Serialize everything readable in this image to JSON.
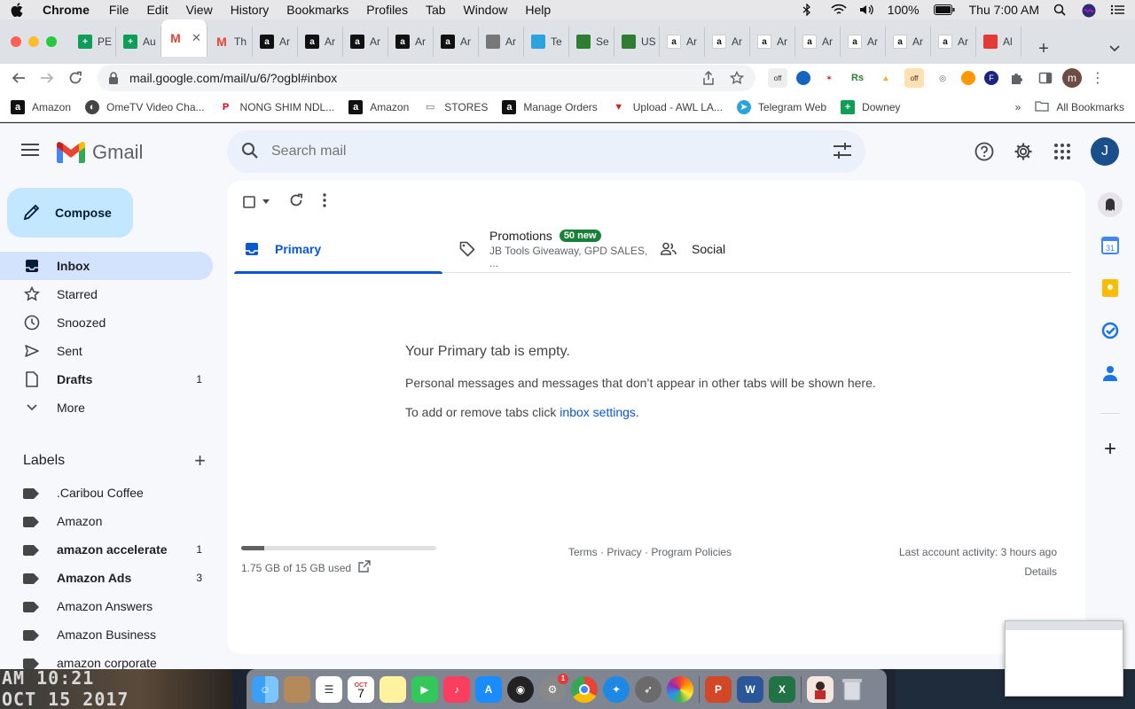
{
  "menubar": {
    "app": "Chrome",
    "items": [
      "File",
      "Edit",
      "View",
      "History",
      "Bookmarks",
      "Profiles",
      "Tab",
      "Window",
      "Help"
    ],
    "battery": "100%",
    "clock": "Thu 7:00 AM"
  },
  "tabs": [
    {
      "label": "PE",
      "icon": "sheets-icon",
      "color": "#0f9d58"
    },
    {
      "label": "Au",
      "icon": "sheets-icon",
      "color": "#0f9d58"
    },
    {
      "label": "",
      "icon": "gmail-icon",
      "color": "#ea4335",
      "active": true
    },
    {
      "label": "Th",
      "icon": "gmail-icon",
      "color": "#ea4335"
    },
    {
      "label": "Ar",
      "icon": "amazon-icon",
      "color": "#111111"
    },
    {
      "label": "Ar",
      "icon": "amazon-icon",
      "color": "#111111"
    },
    {
      "label": "Ar",
      "icon": "amazon-icon",
      "color": "#111111"
    },
    {
      "label": "Ar",
      "icon": "amazon-icon",
      "color": "#111111"
    },
    {
      "label": "Ar",
      "icon": "amazon-icon",
      "color": "#111111"
    },
    {
      "label": "Ar",
      "icon": "generic-icon",
      "color": "#777777"
    },
    {
      "label": "Te",
      "icon": "telegram-icon",
      "color": "#2aa3df"
    },
    {
      "label": "Se",
      "icon": "usfoods-icon",
      "color": "#2e7d32"
    },
    {
      "label": "US",
      "icon": "usfoods-icon",
      "color": "#2e7d32"
    },
    {
      "label": "Ar",
      "icon": "amazon-smile-icon",
      "color": "#ffffff"
    },
    {
      "label": "Ar",
      "icon": "amazon-smile-icon",
      "color": "#ffffff"
    },
    {
      "label": "Ar",
      "icon": "amazon-smile-icon",
      "color": "#ffffff"
    },
    {
      "label": "Ar",
      "icon": "amazon-smile-icon",
      "color": "#ffffff"
    },
    {
      "label": "Ar",
      "icon": "amazon-smile-icon",
      "color": "#ffffff"
    },
    {
      "label": "Ar",
      "icon": "amazon-smile-icon",
      "color": "#ffffff"
    },
    {
      "label": "Ar",
      "icon": "amazon-smile-icon",
      "color": "#ffffff"
    },
    {
      "label": "Al",
      "icon": "pencil-icon",
      "color": "#e53935"
    }
  ],
  "address": {
    "url": "mail.google.com/mail/u/6/?ogbl#inbox"
  },
  "bookmarks": [
    {
      "label": "Amazon",
      "icon": "amazon-icon"
    },
    {
      "label": "OmeTV Video Cha...",
      "icon": "ometv-icon"
    },
    {
      "label": "NONG SHIM NDL...",
      "icon": "pinterest-icon"
    },
    {
      "label": "Amazon",
      "icon": "amazon-icon"
    },
    {
      "label": "STORES",
      "icon": "folder-icon"
    },
    {
      "label": "Manage Orders",
      "icon": "amazon-icon"
    },
    {
      "label": "Upload - AWL LA...",
      "icon": "awl-icon"
    },
    {
      "label": "Telegram Web",
      "icon": "telegram-icon"
    },
    {
      "label": "Downey",
      "icon": "sheets-icon"
    }
  ],
  "bookmarks_more": "»",
  "all_bookmarks": "All Bookmarks",
  "gmail": {
    "brand": "Gmail",
    "search_placeholder": "Search mail",
    "avatar_letter": "J",
    "compose": "Compose",
    "nav": [
      {
        "label": "Inbox",
        "icon": "inbox-icon",
        "count": "",
        "active": true
      },
      {
        "label": "Starred",
        "icon": "star-icon",
        "count": ""
      },
      {
        "label": "Snoozed",
        "icon": "clock-icon",
        "count": ""
      },
      {
        "label": "Sent",
        "icon": "send-icon",
        "count": ""
      },
      {
        "label": "Drafts",
        "icon": "file-icon",
        "count": "1",
        "bold": true
      },
      {
        "label": "More",
        "icon": "chevron-down-icon",
        "count": ""
      }
    ],
    "labels_title": "Labels",
    "labels": [
      {
        "label": ".Caribou Coffee",
        "count": ""
      },
      {
        "label": "Amazon",
        "count": ""
      },
      {
        "label": "amazon accelerate",
        "count": "1",
        "bold": true
      },
      {
        "label": "Amazon Ads",
        "count": "3",
        "bold": true
      },
      {
        "label": "Amazon Answers",
        "count": ""
      },
      {
        "label": "Amazon Business",
        "count": ""
      },
      {
        "label": "amazon corporate",
        "count": ""
      }
    ],
    "tabs": {
      "primary": "Primary",
      "promotions": "Promotions",
      "promotions_badge": "50 new",
      "promotions_sub": "JB Tools Giveaway, GPD SALES, ...",
      "social": "Social"
    },
    "empty": {
      "title": "Your Primary tab is empty.",
      "body": "Personal messages and messages that don’t appear in other tabs will be shown here.",
      "settings_prefix": "To add or remove tabs click ",
      "settings_link": "inbox settings",
      "settings_suffix": "."
    },
    "footer": {
      "storage": "1.75 GB of 15 GB used",
      "storage_fraction": 0.117,
      "policies": "Terms · Privacy · Program Policies",
      "activity": "Last account activity: 3 hours ago",
      "details": "Details"
    }
  },
  "desktop": {
    "clock_overlay_1": "AM 10:21",
    "clock_overlay_2": "OCT 15 2017"
  },
  "dock": {
    "calendar_month": "OCT",
    "calendar_day": "7",
    "badge": "1"
  }
}
